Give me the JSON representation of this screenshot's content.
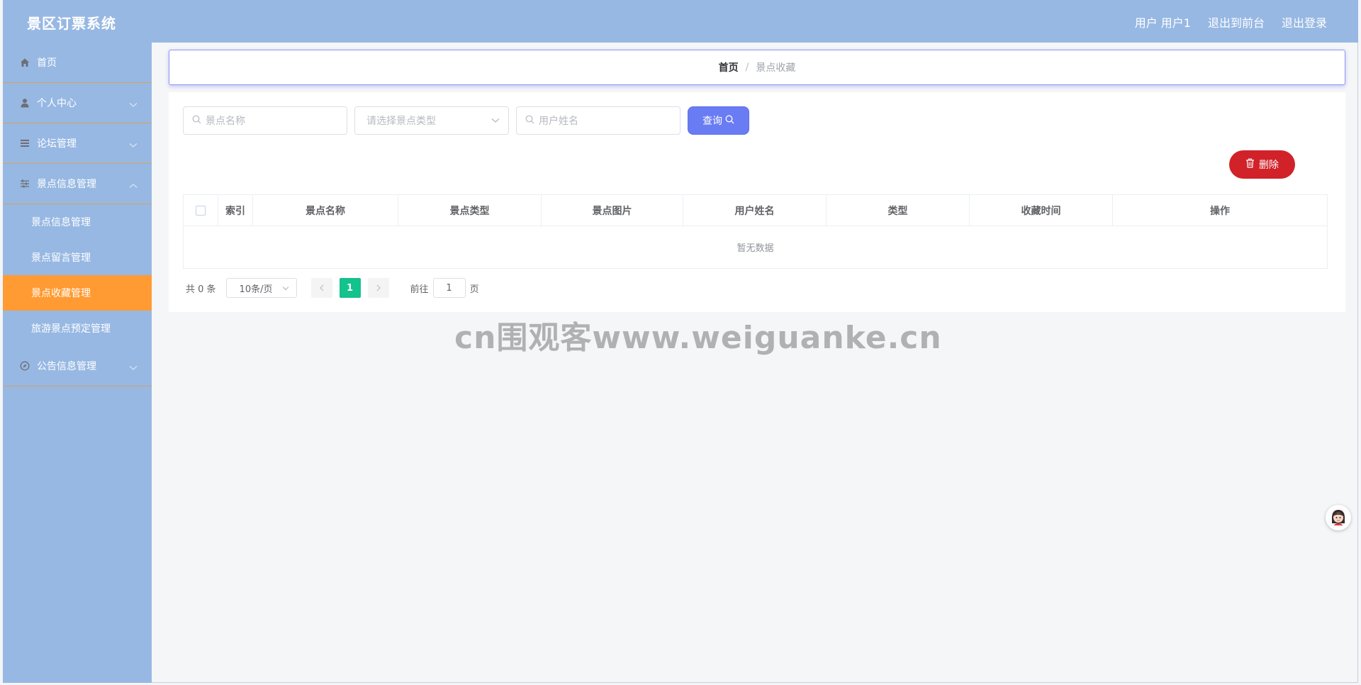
{
  "header": {
    "title": "景区订票系统",
    "user_label": "用户 用户1",
    "back_front_label": "退出到前台",
    "logout_label": "退出登录"
  },
  "sidebar": {
    "items": [
      {
        "label": "首页",
        "icon": "home-icon"
      },
      {
        "label": "个人中心",
        "icon": "user-icon"
      },
      {
        "label": "论坛管理",
        "icon": "list-icon"
      },
      {
        "label": "景点信息管理",
        "icon": "sliders-icon",
        "expanded": true,
        "children": [
          {
            "label": "景点信息管理"
          },
          {
            "label": "景点留言管理"
          },
          {
            "label": "景点收藏管理",
            "active": true
          },
          {
            "label": "旅游景点预定管理"
          }
        ]
      },
      {
        "label": "公告信息管理",
        "icon": "compass-icon"
      }
    ]
  },
  "breadcrumb": {
    "home": "首页",
    "separator": "/",
    "current": "景点收藏"
  },
  "search": {
    "name_placeholder": "景点名称",
    "type_placeholder": "请选择景点类型",
    "user_placeholder": "用户姓名",
    "query_label": "查询"
  },
  "actions": {
    "delete_label": "删除"
  },
  "table": {
    "columns": [
      "索引",
      "景点名称",
      "景点类型",
      "景点图片",
      "用户姓名",
      "类型",
      "收藏时间",
      "操作"
    ],
    "empty_text": "暂无数据"
  },
  "pagination": {
    "total": "共 0 条",
    "page_size": "10条/页",
    "current_page": "1",
    "goto_label": "前往",
    "goto_value": "1",
    "page_unit": "页"
  },
  "watermark": "cn围观客www.weiguanke.cn",
  "colors": {
    "sidebar_bg": "#97b8e3",
    "active_item": "#ff9b32",
    "query_button": "#6a7cf3",
    "delete_button": "#d12229",
    "current_page": "#13c28c"
  }
}
